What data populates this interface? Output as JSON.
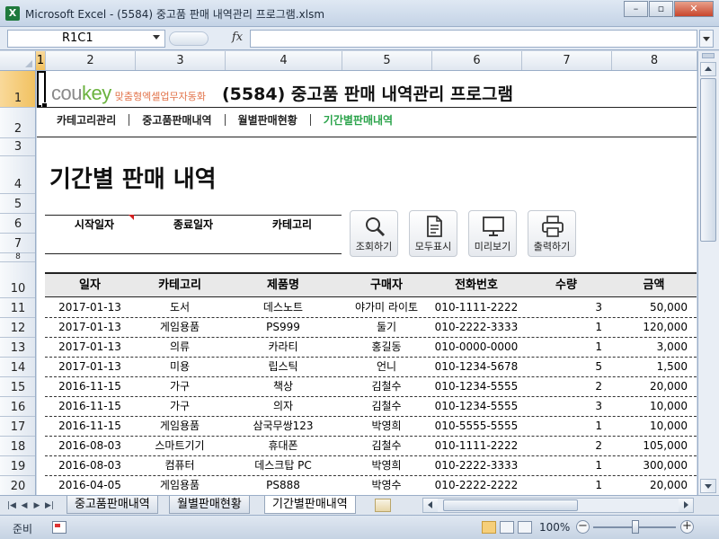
{
  "window": {
    "app_icon": "X",
    "title": "Microsoft Excel - (5584) 중고품 판매 내역관리 프로그램.xlsm",
    "minimize": "–",
    "restore": "▫",
    "close": "✕"
  },
  "formula_bar": {
    "name_box": "R1C1",
    "fx": "fx",
    "formula": ""
  },
  "columns": [
    "1",
    "2",
    "3",
    "4",
    "5",
    "6",
    "7",
    "8"
  ],
  "rows": [
    "1",
    "2",
    "3",
    "4",
    "5",
    "6",
    "7",
    "8",
    "10",
    "11",
    "12",
    "13",
    "14",
    "15",
    "16",
    "17",
    "18",
    "19",
    "20"
  ],
  "brand": {
    "logo_a": "cou",
    "logo_b": "key",
    "tagline": "맞춤형엑셀업무자동화"
  },
  "program_title": "(5584) 중고품 판매 내역관리 프로그램",
  "nav": [
    "카테고리관리",
    "중고품판매내역",
    "월별판매현황",
    "기간별판매내역"
  ],
  "section_title": "기간별 판매 내역",
  "filter": {
    "start_label": "시작일자",
    "end_label": "종료일자",
    "category_label": "카테고리"
  },
  "buttons": {
    "search": "조회하기",
    "show_all": "모두표시",
    "preview": "미리보기",
    "print": "출력하기"
  },
  "table": {
    "headers": [
      "일자",
      "카테고리",
      "제품명",
      "구매자",
      "전화번호",
      "수량",
      "금액"
    ],
    "rows": [
      [
        "2017-01-13",
        "도서",
        "데스노트",
        "야가미 라이토",
        "010-1111-2222",
        "3",
        "50,000"
      ],
      [
        "2017-01-13",
        "게임용품",
        "PS999",
        "둘기",
        "010-2222-3333",
        "1",
        "120,000"
      ],
      [
        "2017-01-13",
        "의류",
        "카라티",
        "홍길동",
        "010-0000-0000",
        "1",
        "3,000"
      ],
      [
        "2017-01-13",
        "미용",
        "립스틱",
        "언니",
        "010-1234-5678",
        "5",
        "1,500"
      ],
      [
        "2016-11-15",
        "가구",
        "책상",
        "김철수",
        "010-1234-5555",
        "2",
        "20,000"
      ],
      [
        "2016-11-15",
        "가구",
        "의자",
        "김철수",
        "010-1234-5555",
        "3",
        "10,000"
      ],
      [
        "2016-11-15",
        "게임용품",
        "삼국무쌍123",
        "박영희",
        "010-5555-5555",
        "1",
        "10,000"
      ],
      [
        "2016-08-03",
        "스마트기기",
        "휴대폰",
        "김철수",
        "010-1111-2222",
        "2",
        "105,000"
      ],
      [
        "2016-08-03",
        "컴퓨터",
        "데스크탑 PC",
        "박영희",
        "010-2222-3333",
        "1",
        "300,000"
      ],
      [
        "2016-04-05",
        "게임용품",
        "PS888",
        "박영수",
        "010-2222-2222",
        "1",
        "20,000"
      ]
    ]
  },
  "sheet_tabs": [
    "중고품판매내역",
    "월별판매현황",
    "기간별판매내역"
  ],
  "status": {
    "ready": "준비",
    "zoom": "100%",
    "minus": "−",
    "plus": "+"
  }
}
